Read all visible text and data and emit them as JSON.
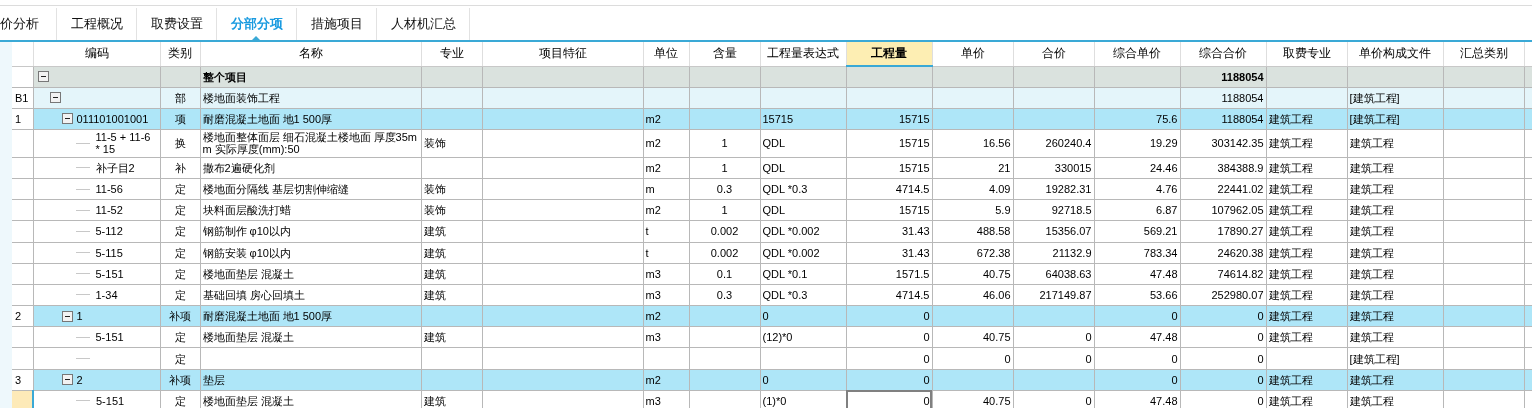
{
  "tabs": [
    {
      "label": "价分析",
      "selected": false
    },
    {
      "label": "工程概况",
      "selected": false
    },
    {
      "label": "取费设置",
      "selected": false
    },
    {
      "label": "分部分项",
      "selected": true
    },
    {
      "label": "措施项目",
      "selected": false
    },
    {
      "label": "人材机汇总",
      "selected": false
    }
  ],
  "table": {
    "columns": [
      {
        "label": "编码",
        "kind": "text",
        "selected": false
      },
      {
        "label": "类别",
        "kind": "center",
        "selected": false
      },
      {
        "label": "名称",
        "kind": "text",
        "selected": false
      },
      {
        "label": "专业",
        "kind": "text",
        "selected": false
      },
      {
        "label": "项目特征",
        "kind": "text",
        "selected": false
      },
      {
        "label": "单位",
        "kind": "text",
        "selected": false
      },
      {
        "label": "含量",
        "kind": "center",
        "selected": false
      },
      {
        "label": "工程量表达式",
        "kind": "text",
        "selected": false
      },
      {
        "label": "工程量",
        "kind": "number",
        "selected": true
      },
      {
        "label": "单价",
        "kind": "number",
        "selected": false
      },
      {
        "label": "合价",
        "kind": "number",
        "selected": false
      },
      {
        "label": "综合单价",
        "kind": "number",
        "selected": false
      },
      {
        "label": "综合合价",
        "kind": "number",
        "selected": false
      },
      {
        "label": "取费专业",
        "kind": "text",
        "selected": false
      },
      {
        "label": "单价构成文件",
        "kind": "text",
        "selected": false
      },
      {
        "label": "汇总类别",
        "kind": "text",
        "selected": false
      }
    ],
    "rows": [
      {
        "kind": "root",
        "selected": false,
        "expanded": true,
        "cells": [
          null,
          null,
          "整个项目",
          null,
          null,
          null,
          null,
          null,
          null,
          null,
          null,
          null,
          "1188054",
          null,
          null,
          null
        ],
        "children": [
          {
            "kind": "division",
            "number": "B1",
            "selected": false,
            "expanded": true,
            "cells": [
              null,
              "部",
              "楼地面装饰工程",
              null,
              null,
              null,
              null,
              null,
              null,
              null,
              null,
              null,
              "1188054",
              null,
              "[建筑工程]",
              null
            ],
            "children": [
              {
                "kind": "item",
                "number": "1",
                "selected": false,
                "expanded": true,
                "cells": [
                  "011101001001",
                  "项",
                  "耐磨混凝土地面 地1 500厚",
                  null,
                  null,
                  "m2",
                  null,
                  "15715",
                  "15715",
                  null,
                  null,
                  "75.6",
                  "1188054",
                  "建筑工程",
                  "[建筑工程]",
                  null
                ],
                "children": [
                  {
                    "kind": "sub",
                    "selected": false,
                    "cells": [
                      "11-5 + 11-6 * 15",
                      "换",
                      "楼地面整体面层 细石混凝土楼地面 厚度35mm  实际厚度(mm):50",
                      "装饰",
                      null,
                      "m2",
                      "1",
                      "QDL",
                      "15715",
                      "16.56",
                      "260240.4",
                      "19.29",
                      "303142.35",
                      "建筑工程",
                      "建筑工程",
                      null
                    ]
                  },
                  {
                    "kind": "sub",
                    "selected": false,
                    "cells": [
                      "补子目2",
                      "补",
                      "撒布2遍硬化剂",
                      null,
                      null,
                      "m2",
                      "1",
                      "QDL",
                      "15715",
                      "21",
                      "330015",
                      "24.46",
                      "384388.9",
                      "建筑工程",
                      "建筑工程",
                      null
                    ]
                  },
                  {
                    "kind": "sub",
                    "selected": false,
                    "cells": [
                      "11-56",
                      "定",
                      "楼地面分隔线 基层切割伸缩缝",
                      "装饰",
                      null,
                      "m",
                      "0.3",
                      "QDL *0.3",
                      "4714.5",
                      "4.09",
                      "19282.31",
                      "4.76",
                      "22441.02",
                      "建筑工程",
                      "建筑工程",
                      null
                    ]
                  },
                  {
                    "kind": "sub",
                    "selected": false,
                    "cells": [
                      "11-52",
                      "定",
                      "块料面层酸洗打蜡",
                      "装饰",
                      null,
                      "m2",
                      "1",
                      "QDL",
                      "15715",
                      "5.9",
                      "92718.5",
                      "6.87",
                      "107962.05",
                      "建筑工程",
                      "建筑工程",
                      null
                    ]
                  },
                  {
                    "kind": "sub",
                    "selected": false,
                    "cells": [
                      "5-112",
                      "定",
                      "钢筋制作 φ10以内",
                      "建筑",
                      null,
                      "t",
                      "0.002",
                      "QDL *0.002",
                      "31.43",
                      "488.58",
                      "15356.07",
                      "569.21",
                      "17890.27",
                      "建筑工程",
                      "建筑工程",
                      null
                    ]
                  },
                  {
                    "kind": "sub",
                    "selected": false,
                    "cells": [
                      "5-115",
                      "定",
                      "钢筋安装 φ10以内",
                      "建筑",
                      null,
                      "t",
                      "0.002",
                      "QDL *0.002",
                      "31.43",
                      "672.38",
                      "21132.9",
                      "783.34",
                      "24620.38",
                      "建筑工程",
                      "建筑工程",
                      null
                    ]
                  },
                  {
                    "kind": "sub",
                    "selected": false,
                    "cells": [
                      "5-151",
                      "定",
                      "楼地面垫层 混凝土",
                      "建筑",
                      null,
                      "m3",
                      "0.1",
                      "QDL *0.1",
                      "1571.5",
                      "40.75",
                      "64038.63",
                      "47.48",
                      "74614.82",
                      "建筑工程",
                      "建筑工程",
                      null
                    ]
                  },
                  {
                    "kind": "sub",
                    "selected": false,
                    "cells": [
                      "1-34",
                      "定",
                      "基础回填 房心回填土",
                      "建筑",
                      null,
                      "m3",
                      "0.3",
                      "QDL *0.3",
                      "4714.5",
                      "46.06",
                      "217149.87",
                      "53.66",
                      "252980.07",
                      "建筑工程",
                      "建筑工程",
                      null
                    ]
                  }
                ]
              },
              {
                "kind": "item",
                "number": "2",
                "selected": false,
                "expanded": true,
                "cells": [
                  "1",
                  "补项",
                  "耐磨混凝土地面 地1 500厚",
                  null,
                  null,
                  "m2",
                  null,
                  "0",
                  "0",
                  null,
                  null,
                  "0",
                  "0",
                  "建筑工程",
                  "建筑工程",
                  null
                ],
                "children": [
                  {
                    "kind": "sub",
                    "selected": false,
                    "cells": [
                      "5-151",
                      "定",
                      "楼地面垫层 混凝土",
                      "建筑",
                      null,
                      "m3",
                      null,
                      "(12)*0",
                      "0",
                      "40.75",
                      "0",
                      "47.48",
                      "0",
                      "建筑工程",
                      "建筑工程",
                      null
                    ]
                  },
                  {
                    "kind": "sub",
                    "selected": false,
                    "cells": [
                      null,
                      "定",
                      null,
                      null,
                      null,
                      null,
                      null,
                      null,
                      "0",
                      "0",
                      "0",
                      "0",
                      "0",
                      null,
                      "[建筑工程]",
                      null
                    ]
                  }
                ]
              },
              {
                "kind": "item",
                "number": "3",
                "selected": false,
                "expanded": true,
                "cells": [
                  "2",
                  "补项",
                  "垫层",
                  null,
                  null,
                  "m2",
                  null,
                  "0",
                  "0",
                  null,
                  null,
                  "0",
                  "0",
                  "建筑工程",
                  "建筑工程",
                  null
                ],
                "children": [
                  {
                    "kind": "sub",
                    "selected": true,
                    "cells": [
                      "5-151",
                      "定",
                      "楼地面垫层 混凝土",
                      "建筑",
                      null,
                      "m3",
                      null,
                      "(1)*0",
                      "0",
                      "40.75",
                      "0",
                      "47.48",
                      "0",
                      "建筑工程",
                      "建筑工程",
                      null
                    ]
                  }
                ]
              }
            ]
          }
        ]
      }
    ]
  }
}
